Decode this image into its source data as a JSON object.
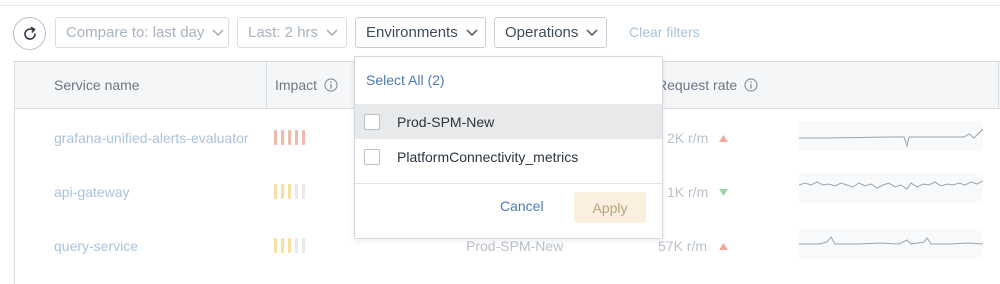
{
  "toolbar": {
    "compare_label": "Compare to: last day",
    "time_label": "Last: 2 hrs",
    "environments_label": "Environments",
    "operations_label": "Operations",
    "clear_filters_label": "Clear filters"
  },
  "table": {
    "headers": {
      "service_name": "Service name",
      "impact": "Impact",
      "request_rate": "Request rate"
    },
    "rows": [
      {
        "service": "grafana-unified-alerts-evaluator",
        "environment": "",
        "rate": "2K r/m",
        "trend": "up",
        "impact_colors": [
          "#f2b8a8",
          "#f2b8a8",
          "#f2b8a8",
          "#f2b8a8",
          "#f2b8a8"
        ]
      },
      {
        "service": "api-gateway",
        "environment": "",
        "rate": "1K r/m",
        "trend": "down",
        "impact_colors": [
          "#f7dfa0",
          "#f7dfa0",
          "#f7dfa0",
          "#e7e9ec",
          "#e7e9ec"
        ]
      },
      {
        "service": "query-service",
        "environment": "Prod-SPM-New",
        "rate": "57K r/m",
        "trend": "up",
        "impact_colors": [
          "#f7dfa0",
          "#f7dfa0",
          "#f7dfa0",
          "#e7e9ec",
          "#e7e9ec"
        ]
      }
    ]
  },
  "dropdown": {
    "select_all_label": "Select All (2)",
    "options": [
      {
        "label": "Prod-SPM-New"
      },
      {
        "label": "PlatformConnectivity_metrics"
      }
    ],
    "cancel_label": "Cancel",
    "apply_label": "Apply"
  },
  "colors": {
    "link": "#4d79b6",
    "trend_up": "#f3a79a",
    "trend_down": "#9fd5a6",
    "apply_bg": "#fbf0df"
  },
  "icons": {
    "refresh": "refresh-icon",
    "chevron": "chevron-down-icon",
    "info": "info-icon"
  }
}
